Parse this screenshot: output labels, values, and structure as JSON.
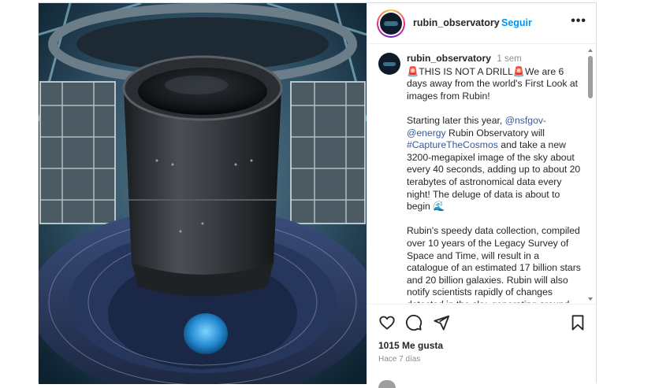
{
  "post": {
    "username": "rubin_observatory",
    "separator": "•",
    "follow_label": "Seguir",
    "more_label": "•••"
  },
  "caption": {
    "username": "rubin_observatory",
    "time": "1 sem",
    "line1_emoji_a": "🚨",
    "line1_text": "THIS IS NOT A DRILL",
    "line1_emoji_b": "🚨",
    "line1_rest": "We are 6 days away from the world's First Look at images from Rubin!",
    "p2_start": "Starting later this year, ",
    "p2_mention": "@nsfgov-@energy",
    "p2_mid": " Rubin Observatory will ",
    "p2_hashtag": "#CaptureTheCosmos",
    "p2_end": " and take a new 3200-megapixel image of the sky about every 40 seconds, adding up to about 20 terabytes of astronomical data every night! The deluge of data is about to begin ",
    "p2_emoji": "🌊",
    "p3": "Rubin's speedy data collection, compiled over 10 years of the Legacy Survey of Space and Time, will result in a catalogue of an estimated 17 billion stars and 20 billion galaxies. Rubin will also notify scientists rapidly of changes detected in the sky, generating around"
  },
  "actions": {
    "like_icon": "heart-icon",
    "comment_icon": "comment-icon",
    "share_icon": "paper-plane-icon",
    "save_icon": "bookmark-icon",
    "likes_text": "1015 Me gusta",
    "time_ago": "Hace 7 días"
  },
  "colors": {
    "link": "#385898",
    "follow": "#0095f6",
    "muted": "#8e8e8e"
  }
}
